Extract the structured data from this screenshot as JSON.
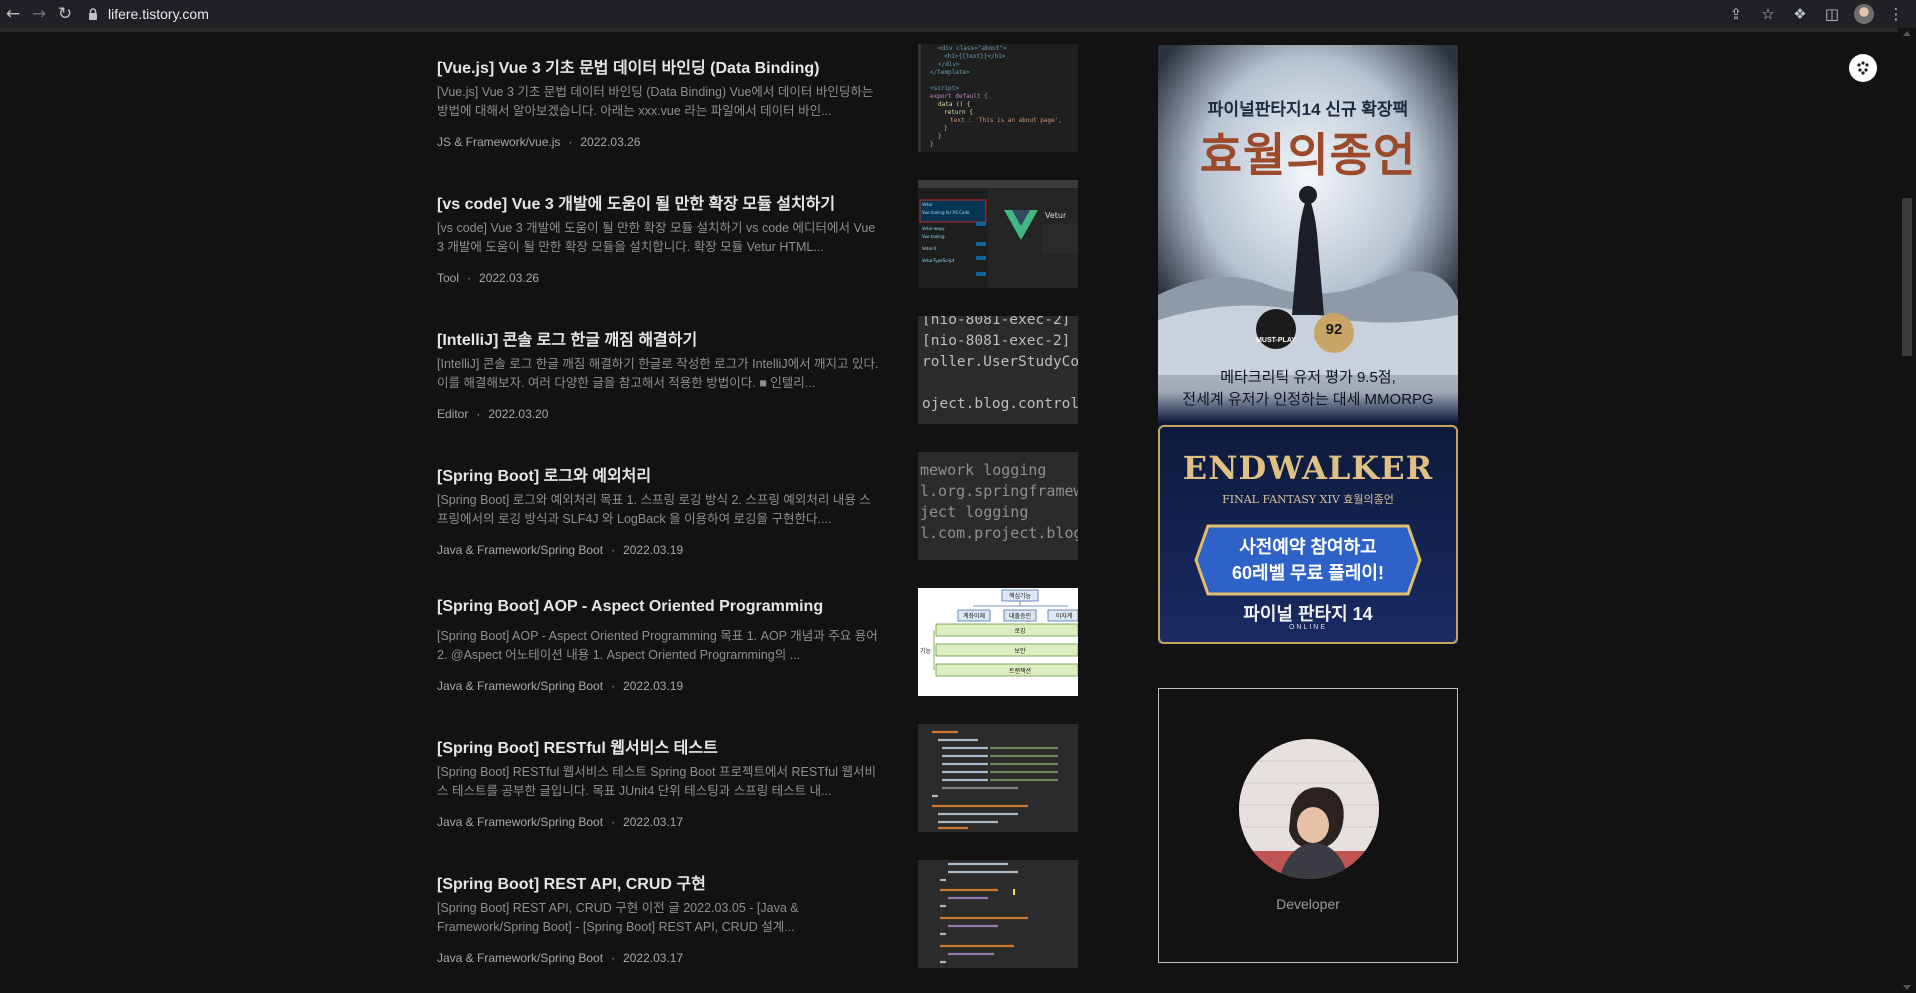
{
  "browser": {
    "url": "lifere.tistory.com"
  },
  "posts": [
    {
      "title": "[Vue.js] Vue 3 기초 문법 데이터 바인딩 (Data Binding)",
      "excerpt": "[Vue.js] Vue 3 기초 문법 데이터 바인딩 (Data Binding) Vue에서 데이터 바인딩하는 방법에 대해서 알아보겠습니다. 아래는 xxx.vue 라는 파일에서 데이터 바인...",
      "category": "JS & Framework/vue.js",
      "date": "2022.03.26"
    },
    {
      "title": "[vs code] Vue 3 개발에 도움이 될 만한 확장 모듈 설치하기",
      "excerpt": "[vs code] Vue 3 개발에 도움이 될 만한 확장 모듈 설치하기 vs code 에디터에서 Vue 3 개발에 도움이 될 만한 확장 모듈을 설치합니다. 확장 모듈 Vetur HTML...",
      "category": "Tool",
      "date": "2022.03.26"
    },
    {
      "title": "[IntelliJ] 콘솔 로그 한글 깨짐 해결하기",
      "excerpt": "[IntelliJ] 콘솔 로그 한글 깨짐 해결하기 한글로 작성한 로그가 IntelliJ에서 깨지고 있다. 이를 해결해보자. 여러 다양한 글을 참고해서 적용한 방법이다. ■ 인텔리...",
      "category": "Editor",
      "date": "2022.03.20"
    },
    {
      "title": "[Spring Boot] 로그와 예외처리",
      "excerpt": "[Spring Boot] 로그와 예외처리 목표 1. 스프링 로깅 방식 2. 스프링 예외처리 내용 스프링에서의 로깅 방식과 SLF4J 와 LogBack 을 이용하여 로깅을 구현한다....",
      "category": "Java & Framework/Spring Boot",
      "date": "2022.03.19"
    },
    {
      "title": "[Spring Boot] AOP - Aspect Oriented Programming",
      "excerpt": "[Spring Boot] AOP - Aspect Oriented Programming 목표 1. AOP 개념과 주요 용어 2. @Aspect 어노테이션 내용 1. Aspect Oriented Programming의 ...",
      "category": "Java & Framework/Spring Boot",
      "date": "2022.03.19"
    },
    {
      "title": "[Spring Boot] RESTful 웹서비스 테스트",
      "excerpt": "[Spring Boot] RESTful 웹서비스 테스트 Spring Boot 프로젝트에서 RESTful 웹서비스 테스트를 공부한 글입니다. 목표 JUnit4 단위 테스팅과 스프링 테스트 내...",
      "category": "Java & Framework/Spring Boot",
      "date": "2022.03.17"
    },
    {
      "title": "[Spring Boot] REST API, CRUD 구현",
      "excerpt": "[Spring Boot] REST API, CRUD 구현 이전 글 2022.03.05 - [Java & Framework/Spring Boot] - [Spring Boot] REST API, CRUD 설계...",
      "category": "Java & Framework/Spring Boot",
      "date": "2022.03.17"
    }
  ],
  "thumbs": {
    "log_lines": [
      "[nio-8081-exec-2]",
      "[nio-8081-exec-2]",
      "roller.UserStudyCon",
      "oject.blog.controlle"
    ],
    "logging_lines": [
      "mework logging",
      "l.org.springframew",
      "ject logging",
      "l.com.project.blog"
    ],
    "aop_labels": [
      "핵심기능",
      "계좌이체",
      "대출승인",
      "이자계",
      "로깅",
      "보안",
      "트랜잭션",
      "기능"
    ],
    "vetur_label": "Vetur"
  },
  "ad": {
    "headline": "파이널판타지14 신규 확장팩",
    "title": "효월의종언",
    "badge_metacritic": "MUST-PLAY",
    "badge_score": "92",
    "line1": "메타크리틱 유저 평가 9.5점,",
    "line2": "전세계 유저가 인정하는 대세 MMORPG",
    "logo": "ENDWALKER",
    "logo_sub": "FINAL FANTASY XIV 효월의종언",
    "cta_line1": "사전예약 참여하고",
    "cta_line2": "60레벨 무료 플레이!",
    "footer": "파이널 판타지 14",
    "footer_sub": "ONLINE"
  },
  "profile": {
    "label": "Developer"
  }
}
